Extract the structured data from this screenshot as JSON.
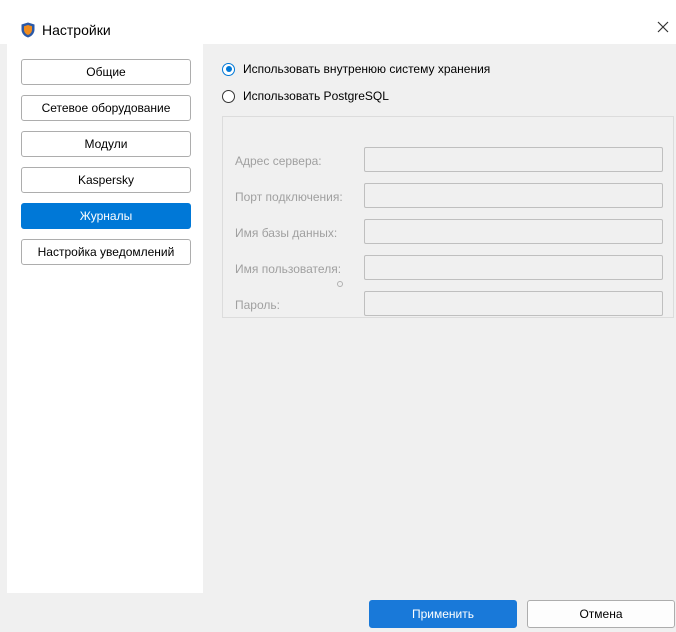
{
  "window": {
    "title": "Настройки"
  },
  "sidebar": {
    "items": [
      {
        "label": "Общие",
        "active": false
      },
      {
        "label": "Сетевое оборудование",
        "active": false
      },
      {
        "label": "Модули",
        "active": false
      },
      {
        "label": "Kaspersky",
        "active": false
      },
      {
        "label": "Журналы",
        "active": true
      },
      {
        "label": "Настройка уведомлений",
        "active": false
      }
    ]
  },
  "storage": {
    "options": [
      {
        "label": "Использовать внутренюю систему хранения",
        "checked": true
      },
      {
        "label": "Использовать PostgreSQL",
        "checked": false
      }
    ],
    "fields": [
      {
        "label": "Адрес сервера:",
        "value": ""
      },
      {
        "label": "Порт подключения:",
        "value": ""
      },
      {
        "label": "Имя базы данных:",
        "value": ""
      },
      {
        "label": "Имя пользователя:",
        "value": ""
      },
      {
        "label": "Пароль:",
        "value": ""
      }
    ]
  },
  "footer": {
    "apply_label": "Применить",
    "cancel_label": "Отмена"
  },
  "colors": {
    "accent": "#0078d7",
    "apply_button": "#1979d9",
    "disabled_text": "#a0a0a0",
    "background": "#f0f0f0"
  }
}
